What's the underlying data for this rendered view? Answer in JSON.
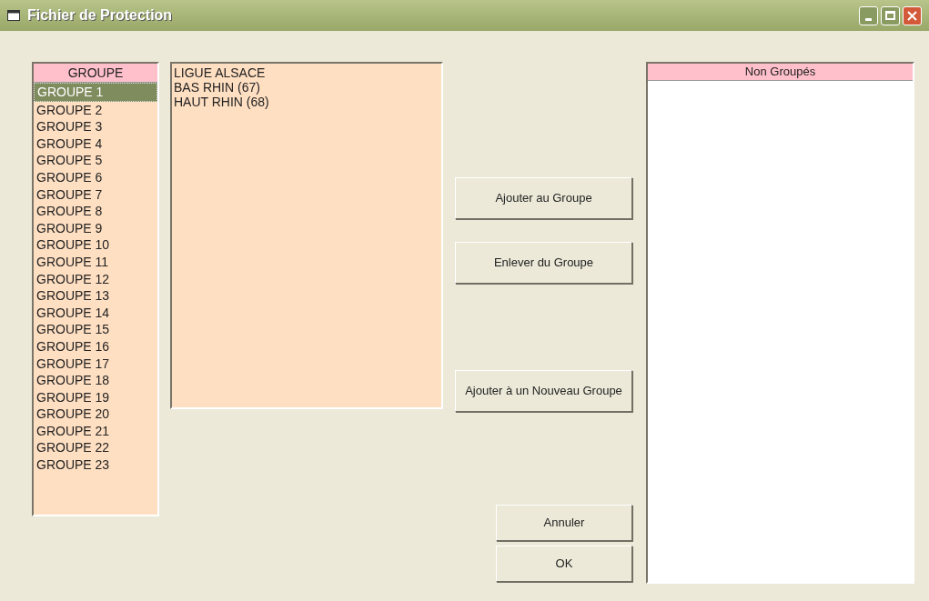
{
  "window": {
    "title": "Fichier de Protection"
  },
  "groups": {
    "header": "GROUPE",
    "items": [
      {
        "label": "GROUPE 1",
        "selected": true
      },
      {
        "label": "GROUPE 2",
        "selected": false
      },
      {
        "label": "GROUPE 3",
        "selected": false
      },
      {
        "label": "GROUPE 4",
        "selected": false
      },
      {
        "label": "GROUPE 5",
        "selected": false
      },
      {
        "label": "GROUPE 6",
        "selected": false
      },
      {
        "label": "GROUPE 7",
        "selected": false
      },
      {
        "label": "GROUPE 8",
        "selected": false
      },
      {
        "label": "GROUPE 9",
        "selected": false
      },
      {
        "label": "GROUPE 10",
        "selected": false
      },
      {
        "label": "GROUPE 11",
        "selected": false
      },
      {
        "label": "GROUPE 12",
        "selected": false
      },
      {
        "label": "GROUPE 13",
        "selected": false
      },
      {
        "label": "GROUPE 14",
        "selected": false
      },
      {
        "label": "GROUPE 15",
        "selected": false
      },
      {
        "label": "GROUPE 16",
        "selected": false
      },
      {
        "label": "GROUPE 17",
        "selected": false
      },
      {
        "label": "GROUPE 18",
        "selected": false
      },
      {
        "label": "GROUPE 19",
        "selected": false
      },
      {
        "label": "GROUPE 20",
        "selected": false
      },
      {
        "label": "GROUPE 21",
        "selected": false
      },
      {
        "label": "GROUPE 22",
        "selected": false
      },
      {
        "label": "GROUPE 23",
        "selected": false
      }
    ]
  },
  "members": [
    "LIGUE ALSACE",
    "BAS RHIN (67)",
    "HAUT RHIN (68)"
  ],
  "actions": [
    "Ajouter au Groupe",
    "Enlever du Groupe",
    "Ajouter à un Nouveau Groupe"
  ],
  "dialog_buttons": [
    "Annuler",
    "OK"
  ],
  "ungrouped": {
    "header": "Non Groupés"
  }
}
